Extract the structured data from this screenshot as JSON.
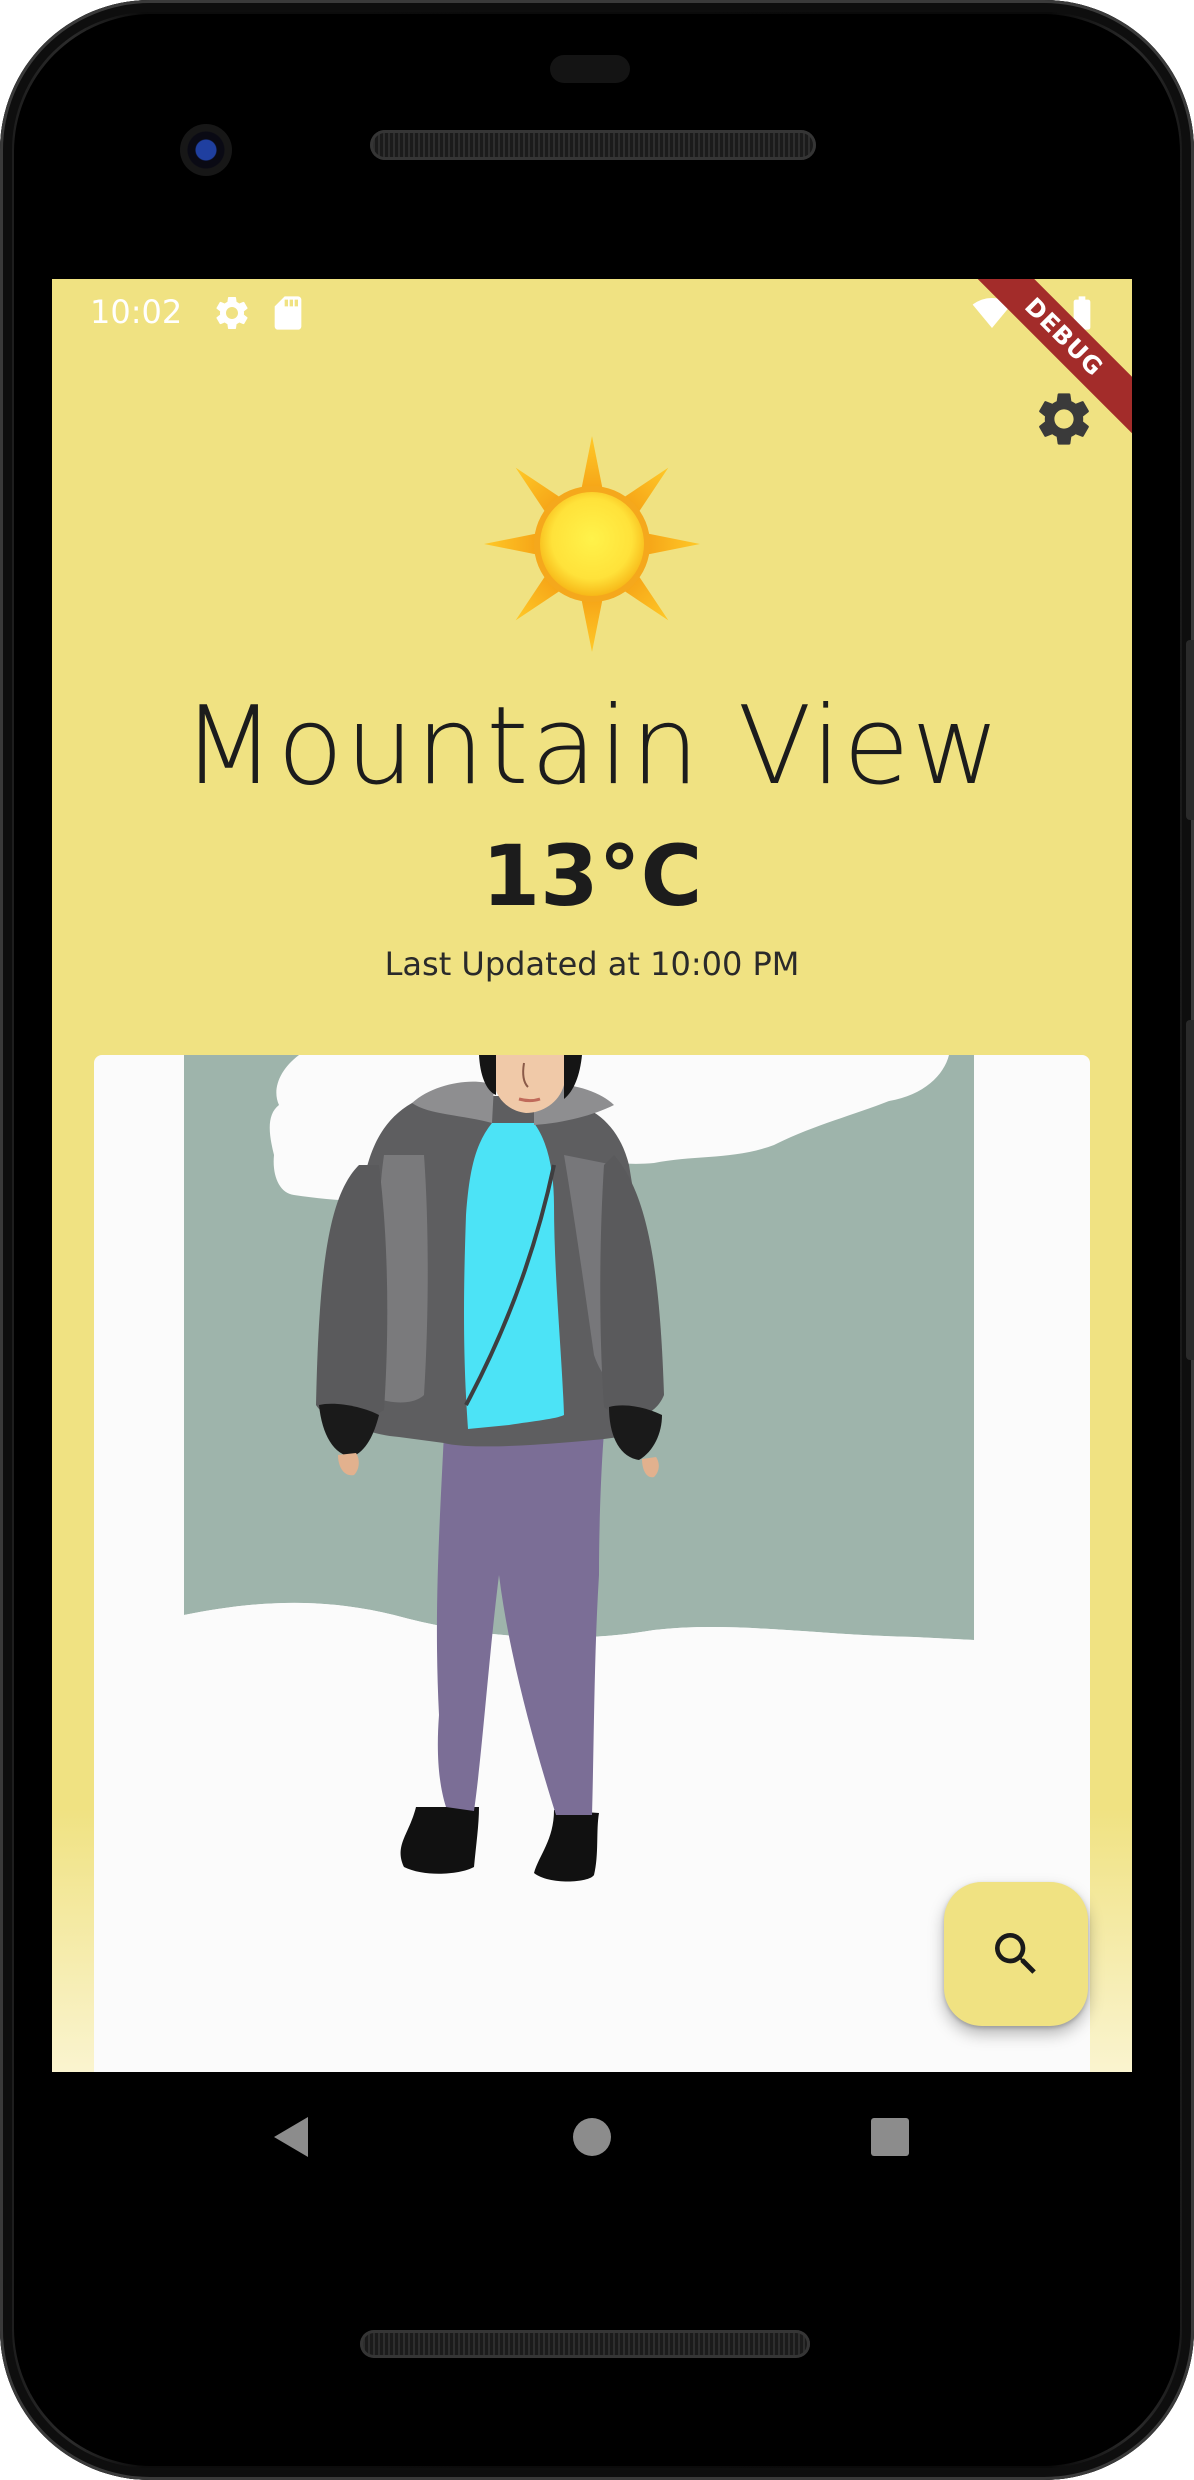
{
  "status_bar": {
    "time": "10:02",
    "icons": [
      "gear-icon",
      "sd-card-icon",
      "wifi-icon",
      "battery-icon"
    ],
    "debug_banner": "DEBUG"
  },
  "app": {
    "background_color": "#F0E282",
    "settings_icon": "gear-icon",
    "weather_icon": "sun-icon",
    "city": "Mountain View",
    "temperature": "13°C",
    "last_updated": "Last Updated at 10:00 PM",
    "fab_icon": "search-icon"
  },
  "nav_bar": {
    "buttons": [
      "back-icon",
      "home-icon",
      "recents-icon"
    ]
  }
}
